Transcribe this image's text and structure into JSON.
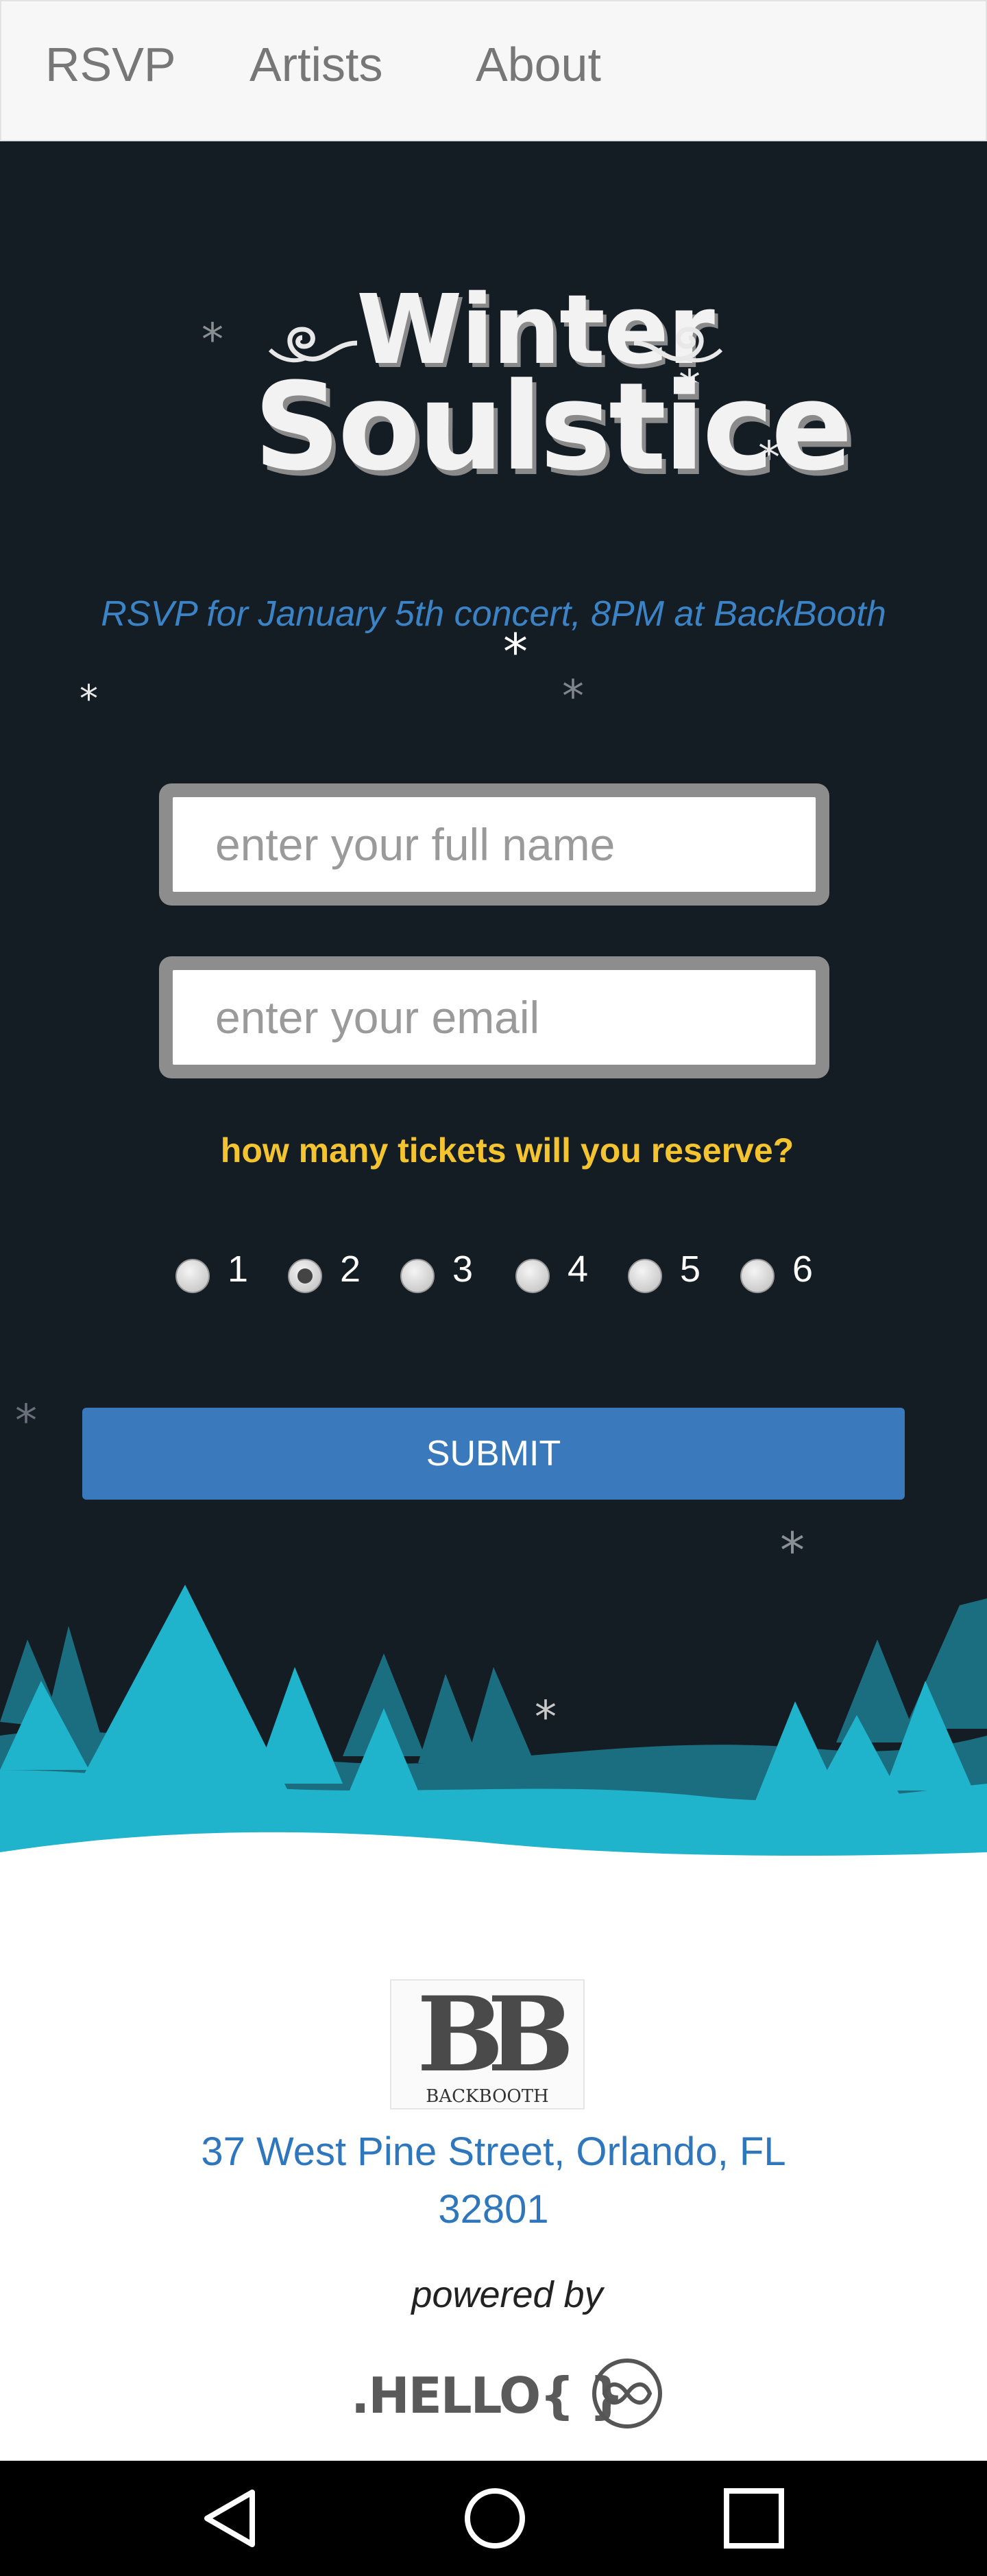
{
  "nav": {
    "items": [
      "RSVP",
      "Artists",
      "About"
    ]
  },
  "hero": {
    "title_line1": "Winter",
    "title_line2": "Soulstice",
    "subtitle": "RSVP for January 5th concert, 8PM at BackBooth",
    "snow_glyph": "*"
  },
  "form": {
    "name_placeholder": "enter your full name",
    "email_placeholder": "enter your email",
    "question": "how many tickets will you reserve?",
    "ticket_options": [
      "1",
      "2",
      "3",
      "4",
      "5",
      "6"
    ],
    "selected_tickets": "2",
    "submit_label": "SUBMIT"
  },
  "footer": {
    "logo_text": "BB",
    "logo_caption": "BACKBOOTH",
    "address_line1": "37 West Pine Street, Orlando, FL",
    "address_line2": "32801",
    "powered_by": "powered by",
    "hello_logo": ".HELLO{ }"
  },
  "colors": {
    "hero_bg": "#141c24",
    "accent_blue": "#3a7abc",
    "question_yellow": "#f4c430",
    "tree_light": "#1fb3cc",
    "tree_dark": "#1a6e80"
  },
  "system_nav": {
    "icons": [
      "back-icon",
      "home-icon",
      "recents-icon"
    ]
  }
}
